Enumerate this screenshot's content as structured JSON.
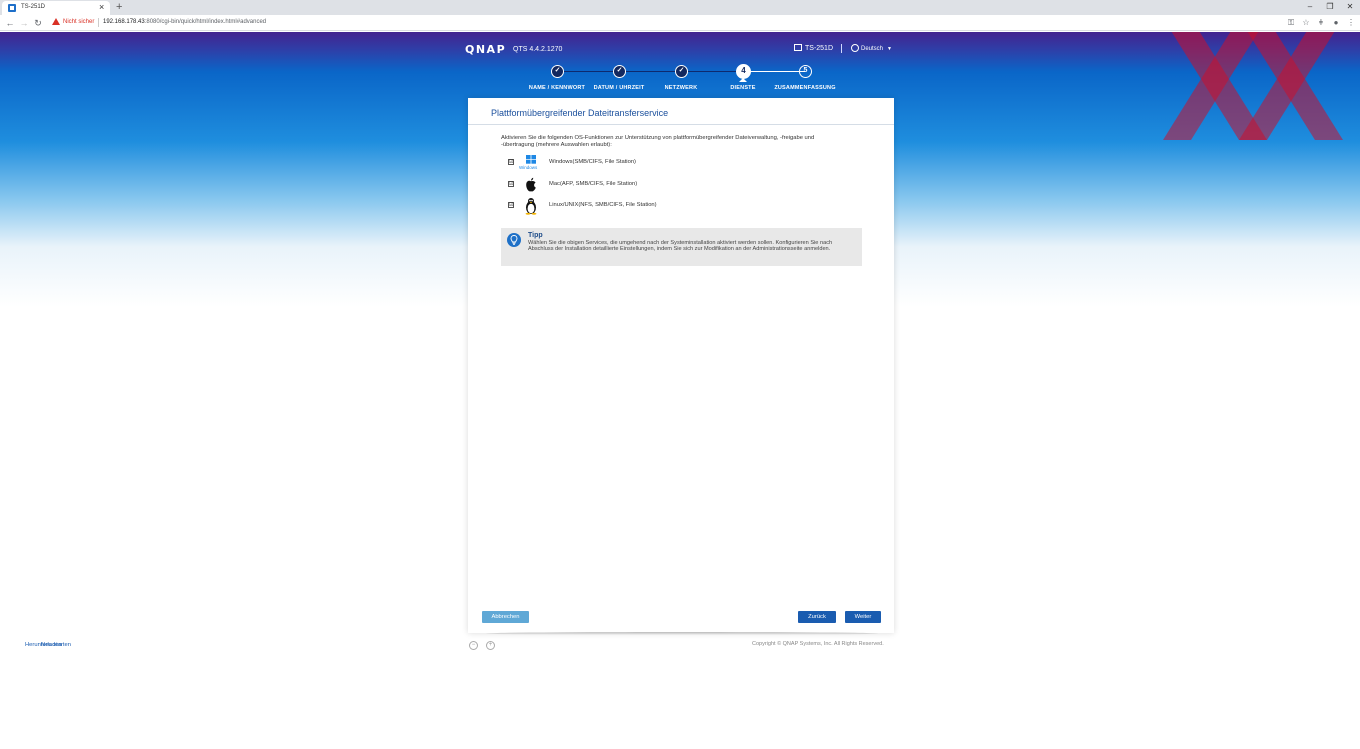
{
  "browser": {
    "tab_title": "TS-251D",
    "tab_close": "×",
    "new_tab": "+",
    "window_controls": [
      "–",
      "❐",
      "✕"
    ],
    "security_label": "Nicht sicher",
    "url_host": "192.168.178.43",
    "url_rest": ":8080/cgi-bin/quick/html/index.html#advanced"
  },
  "header": {
    "logo": "QNAP",
    "version": "QTS 4.4.2.1270",
    "device_name": "TS-251D",
    "language": "Deutsch"
  },
  "stepper": {
    "steps": [
      {
        "mark": "✓",
        "label": "NAME / KENNWORT",
        "state": "done"
      },
      {
        "mark": "✓",
        "label": "DATUM / UHRZEIT",
        "state": "done"
      },
      {
        "mark": "✓",
        "label": "NETZWERK",
        "state": "done"
      },
      {
        "mark": "4",
        "label": "DIENSTE",
        "state": "current"
      },
      {
        "mark": "5",
        "label": "ZUSAMMENFASSUNG",
        "state": "todo"
      }
    ]
  },
  "panel": {
    "title": "Plattformübergreifender Dateitransferservice",
    "intro": "Aktivieren Sie die folgenden OS-Funktionen zur Unterstützung von plattformübergreifender Dateiverwaltung, -freigabe und -übertragung (mehrere Auswahlen erlaubt):",
    "os_options": [
      {
        "icon": "windows-logo-icon",
        "icon_caption": "Windows",
        "label": "Windows(SMB/CIFS, File Station)",
        "checked": true
      },
      {
        "icon": "apple-logo-icon",
        "label": "Mac(AFP, SMB/CIFS, File Station)",
        "checked": true
      },
      {
        "icon": "linux-tux-icon",
        "label": "Linux/UNIX(NFS, SMB/CIFS, File Station)",
        "checked": true
      }
    ],
    "check_mark": "☑",
    "tip": {
      "title": "Tipp",
      "text": "Wählen Sie die obigen Services, die umgehend nach der Systeminstallation aktiviert werden sollen. Konfigurieren Sie nach Abschluss der Installation detaillierte Einstellungen, indem Sie sich zur Modifikation an der Administrationsseite anmelden."
    },
    "buttons": {
      "cancel": "Abbrechen",
      "back": "Zurück",
      "next": "Weiter"
    }
  },
  "footer": {
    "link": "Herunterladen",
    "link_overlap": "Neu starten",
    "copyright": "Copyright © QNAP Systems, Inc. All Rights Reserved."
  },
  "colors": {
    "accent": "#1a5cb0",
    "step_done": "#12285f",
    "watermark": "#c8102e"
  }
}
